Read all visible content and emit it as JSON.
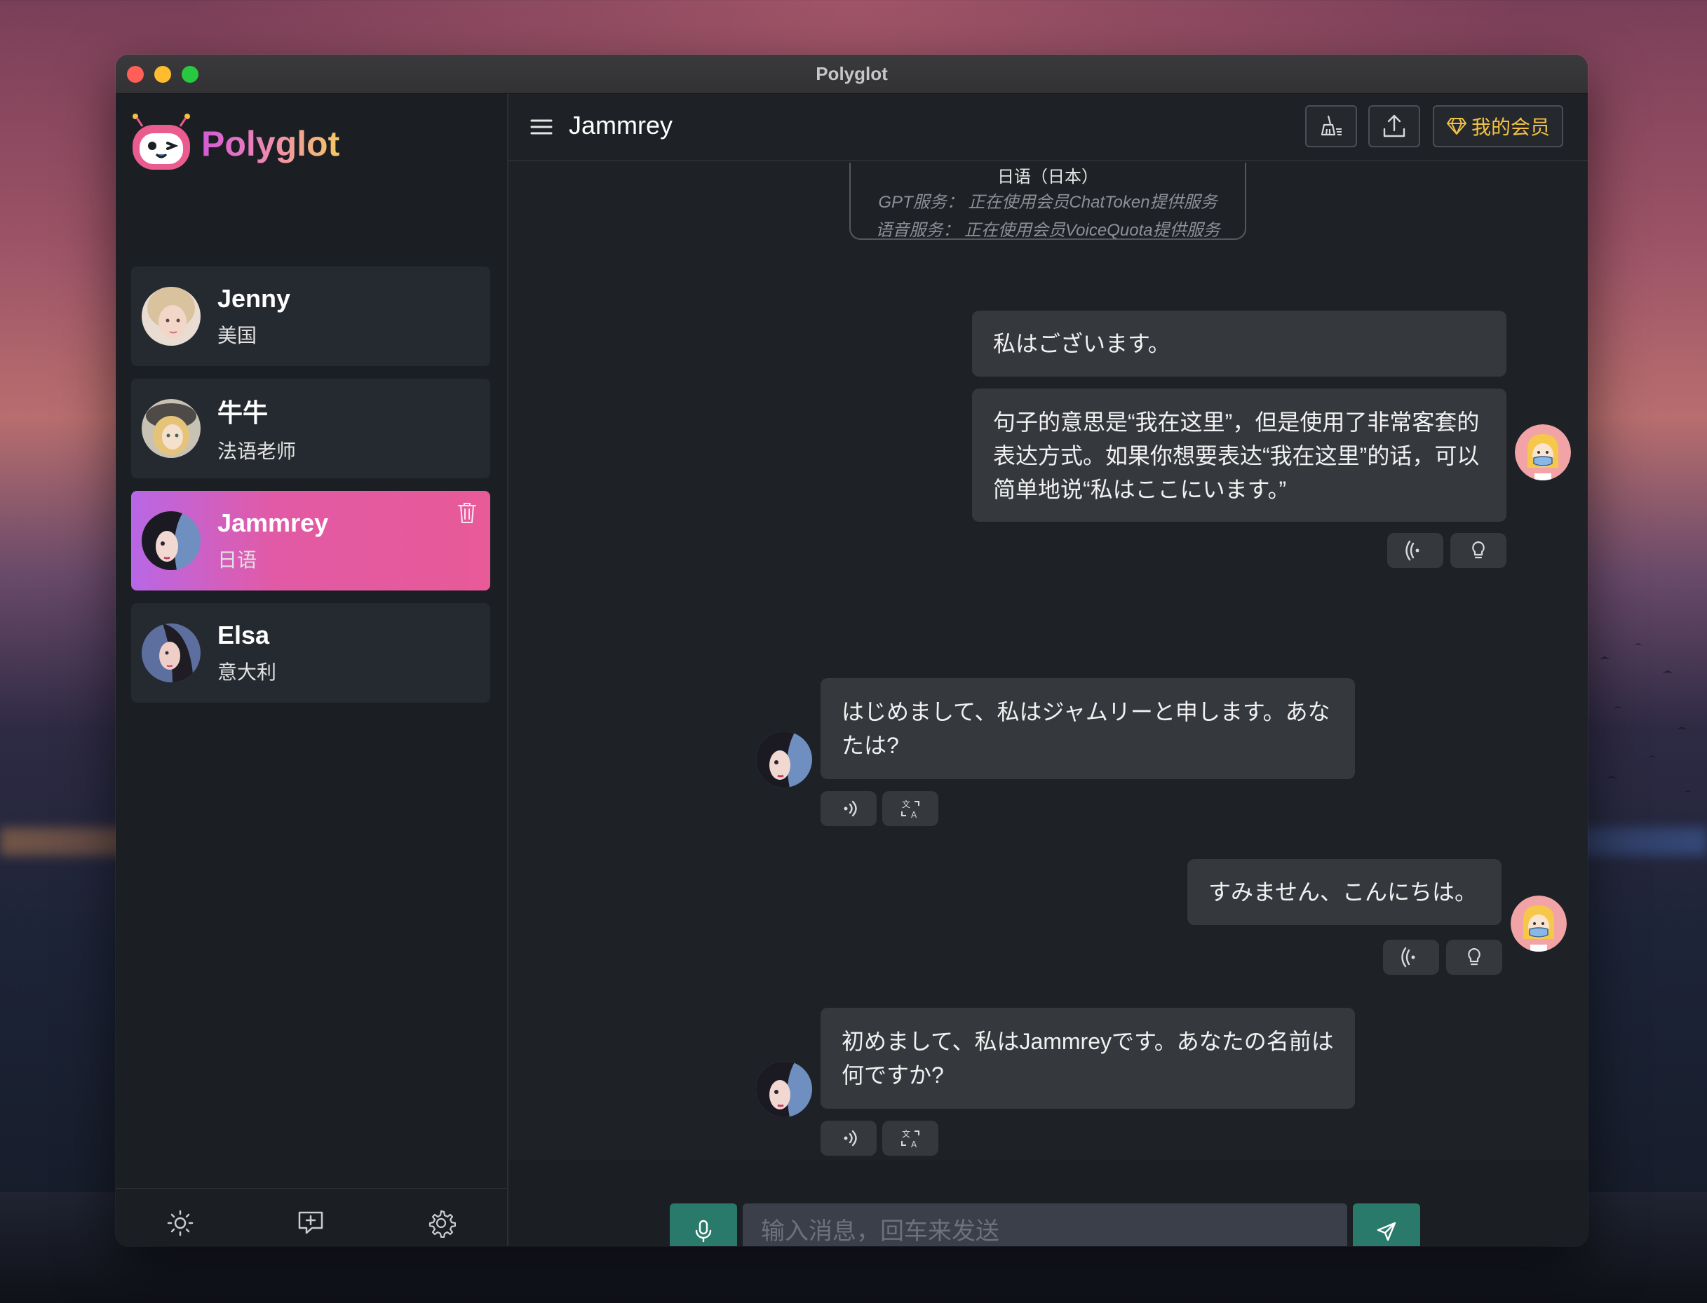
{
  "window": {
    "title": "Polyglot"
  },
  "brand": {
    "name": "Polyglot"
  },
  "contacts": [
    {
      "name": "Jenny",
      "sub": "美国",
      "active": false
    },
    {
      "name": "牛牛",
      "sub": "法语老师",
      "active": false
    },
    {
      "name": "Jammrey",
      "sub": "日语",
      "active": true
    },
    {
      "name": "Elsa",
      "sub": "意大利",
      "active": false
    }
  ],
  "footer_icons": [
    "sun-icon",
    "add-chat-icon",
    "gear-icon"
  ],
  "header": {
    "title": "Jammrey",
    "vip_label": "我的会员",
    "icons": [
      "menu-icon",
      "broom-icon",
      "upload-icon",
      "diamond-icon"
    ]
  },
  "info_card": {
    "language": "日语（日本）",
    "gpt_line": "GPT服务：  正在使用会员ChatToken提供服务",
    "voice_line": "语音服务：  正在使用会员VoiceQuota提供服务"
  },
  "messages": [
    {
      "from": "user",
      "text": "私はございます。"
    },
    {
      "from": "user",
      "text": "句子的意思是“我在这里”，但是使用了非常客套的表达方式。如果你想要表达“我在这里”的话，可以简单地说“私はここにいます。”"
    },
    {
      "from": "bot",
      "text": "はじめまして、私はジャムリーと申します。あなたは?"
    },
    {
      "from": "user",
      "text": "すみません、こんにちは。"
    },
    {
      "from": "bot",
      "text": "初めまして、私はJammreyです。あなたの名前は何ですか?"
    }
  ],
  "input": {
    "placeholder": "输入消息，回车来发送",
    "value": ""
  },
  "colors": {
    "accent_green": "#2a7a6c",
    "active_gradient_start": "#b867e6",
    "active_gradient_end": "#e85a98",
    "vip_gold": "#f3c244"
  }
}
